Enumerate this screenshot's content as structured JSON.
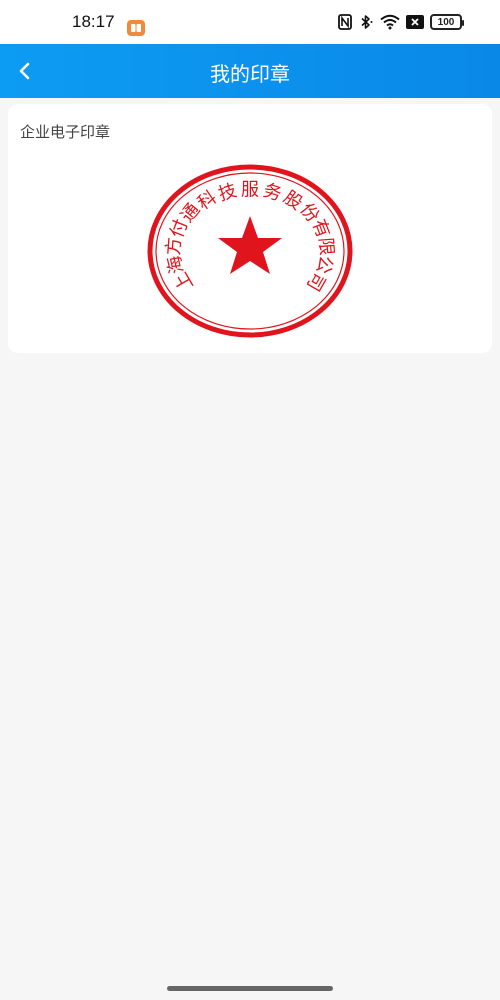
{
  "status_bar": {
    "time": "18:17",
    "battery": "100",
    "icons": [
      "app-notification-icon",
      "nfc-icon",
      "bluetooth-icon",
      "wifi-icon",
      "sim-off-icon",
      "battery-icon"
    ]
  },
  "header": {
    "title": "我的印章",
    "back_icon": "chevron-left-icon"
  },
  "seal_card": {
    "label": "企业电子印章",
    "seal_text": "上海方付通科技服务股份有限公司",
    "seal_color": "#e0141c"
  },
  "colors": {
    "header_accent": "#0a8fed",
    "page_background": "#f6f6f6"
  }
}
